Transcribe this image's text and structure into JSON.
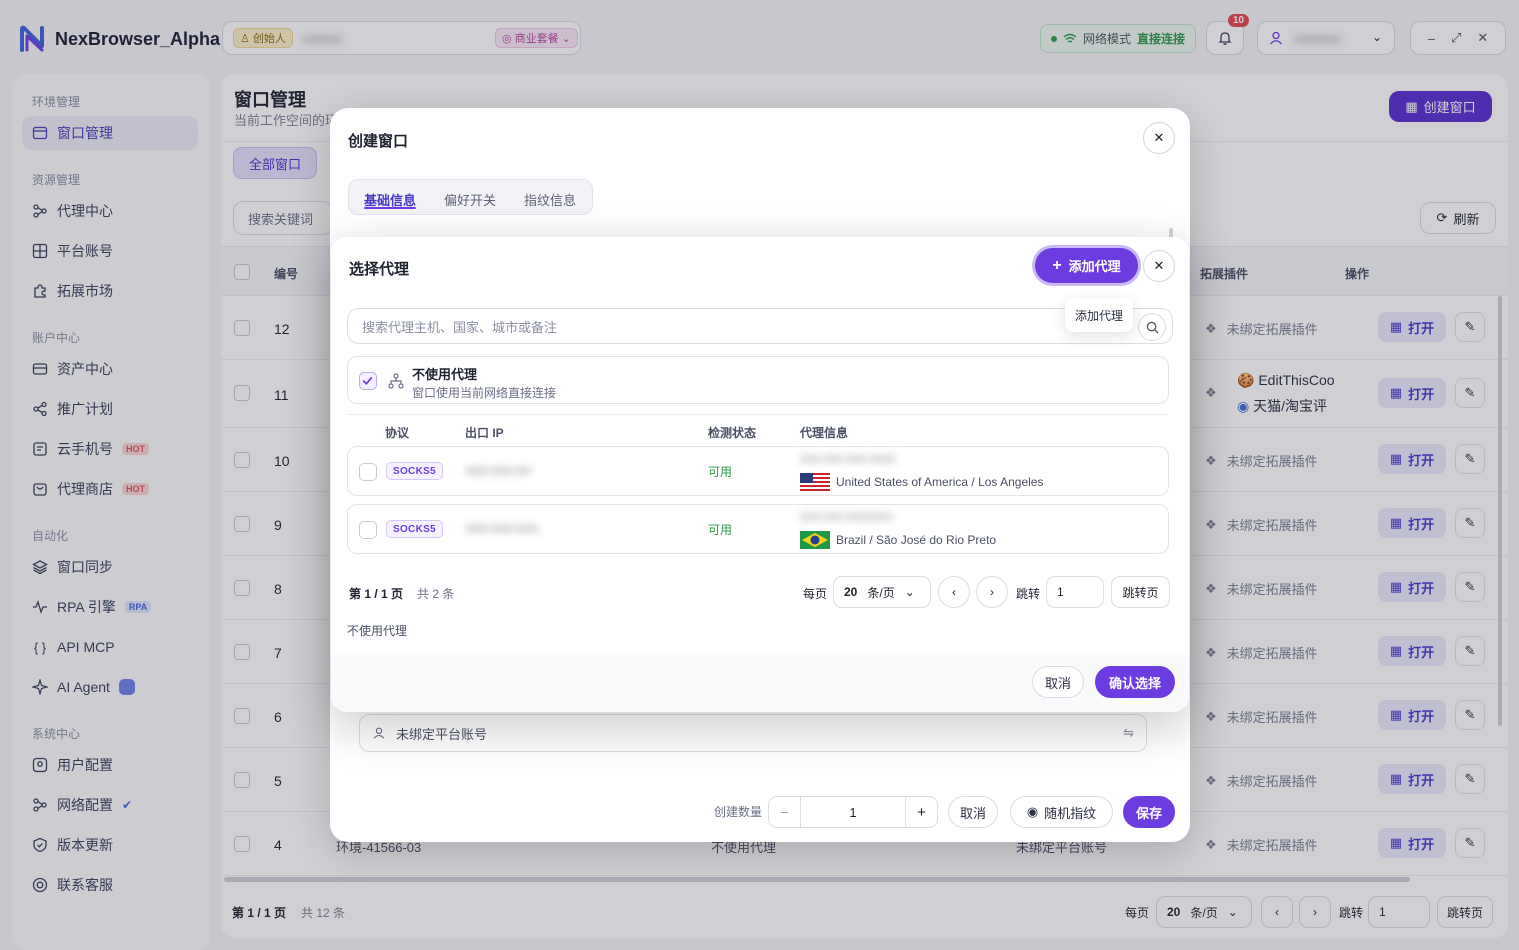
{
  "app": {
    "name": "NexBrowser_Alpha",
    "role_chip": "创始人",
    "user_name": "●●●●●",
    "plan_chip": "商业套餐",
    "net_label": "网络模式",
    "net_value": "直接连接",
    "notify_count": "10",
    "account_name": "●●●●●●"
  },
  "colors": {
    "accent": "#6d3ce0",
    "success": "#2e9a4b",
    "hot": "#e05757"
  },
  "sidebar": {
    "groups": [
      "环境管理",
      "资源管理",
      "账户中心",
      "自动化",
      "系统中心"
    ],
    "items": [
      {
        "label": "窗口管理",
        "icon": "window-icon"
      },
      {
        "label": "代理中心",
        "icon": "proxy-icon"
      },
      {
        "label": "平台账号",
        "icon": "grid-icon"
      },
      {
        "label": "拓展市场",
        "icon": "puzzle-icon"
      },
      {
        "label": "资产中心",
        "icon": "wallet-icon"
      },
      {
        "label": "推广计划",
        "icon": "share-icon"
      },
      {
        "label": "云手机号",
        "icon": "phone-icon",
        "badge": "HOT"
      },
      {
        "label": "代理商店",
        "icon": "shop-icon",
        "badge": "HOT"
      },
      {
        "label": "窗口同步",
        "icon": "layers-icon"
      },
      {
        "label": "RPA 引擎",
        "icon": "pulse-icon",
        "badge": "RPA"
      },
      {
        "label": "API MCP",
        "icon": "braces-icon"
      },
      {
        "label": "AI Agent",
        "icon": "sparkle-icon"
      },
      {
        "label": "用户配置",
        "icon": "user-config-icon"
      },
      {
        "label": "网络配置",
        "icon": "network-icon"
      },
      {
        "label": "版本更新",
        "icon": "shield-icon"
      },
      {
        "label": "联系客服",
        "icon": "support-icon"
      }
    ]
  },
  "main": {
    "title": "窗口管理",
    "subtitle": "当前工作空间的环",
    "create_button": "创建窗口",
    "filter_all": "全部窗口",
    "search_placeholder": "搜索关键词",
    "refresh": "刷新",
    "columns": {
      "id": "编号",
      "ext": "拓展插件",
      "ops": "操作"
    },
    "rows": [
      {
        "id": "12",
        "ext": "未绑定拓展插件"
      },
      {
        "id": "11",
        "ext": "EditThisCoo",
        "ext2": "天猫/淘宝评"
      },
      {
        "id": "10",
        "ext": "未绑定拓展插件"
      },
      {
        "id": "9",
        "ext": "未绑定拓展插件"
      },
      {
        "id": "8",
        "ext": "未绑定拓展插件"
      },
      {
        "id": "7",
        "ext": "未绑定拓展插件"
      },
      {
        "id": "6",
        "ext": "未绑定拓展插件"
      },
      {
        "id": "5",
        "ext": "未绑定拓展插件"
      },
      {
        "id": "4",
        "ext": "未绑定拓展插件",
        "name": "环境-41566-03",
        "proxy": "不使用代理",
        "account": "未绑定平台账号"
      }
    ],
    "open_label": "打开",
    "pagination": {
      "page": "第 1 / 1 页",
      "total": "共 12 条",
      "per_page_label": "每页",
      "per_page": "20",
      "per_page_unit": "条/页",
      "jump_label": "跳转",
      "jump_value": "1",
      "jump_btn": "跳转页"
    }
  },
  "create_modal": {
    "title": "创建窗口",
    "tabs": [
      "基础信息",
      "偏好开关",
      "指纹信息"
    ],
    "account_field": "未绑定平台账号",
    "count_label": "创建数量",
    "count": "1",
    "minus": "−",
    "plus": "+",
    "cancel": "取消",
    "random_fp": "随机指纹",
    "save": "保存"
  },
  "proxy_modal": {
    "title": "选择代理",
    "add_button": "添加代理",
    "tooltip": "添加代理",
    "search_placeholder": "搜索代理主机、国家、城市或备注",
    "no_proxy_title": "不使用代理",
    "no_proxy_desc": "窗口使用当前网络直接连接",
    "columns": {
      "protocol": "协议",
      "exit_ip": "出口 IP",
      "status": "检测状态",
      "info": "代理信息"
    },
    "proxies": [
      {
        "protocol": "SOCKS5",
        "ip": "●●●.●●●.●●",
        "status": "可用",
        "host": "●●●.●●●.●●●.●●●●",
        "location": "United States of America / Los Angeles",
        "flag": "us-flag"
      },
      {
        "protocol": "SOCKS5",
        "ip": "●●●.●●●.●●●",
        "status": "可用",
        "host": "●●●.●●●.●●●●●●●",
        "location": "Brazil / São José do Rio Preto",
        "flag": "br-flag"
      }
    ],
    "pagination": {
      "page": "第 1 / 1 页",
      "total": "共 2 条",
      "per_page_label": "每页",
      "per_page": "20",
      "per_page_unit": "条/页",
      "jump_label": "跳转",
      "jump_value": "1",
      "jump_btn": "跳转页"
    },
    "selected_text": "不使用代理",
    "cancel": "取消",
    "confirm": "确认选择"
  }
}
